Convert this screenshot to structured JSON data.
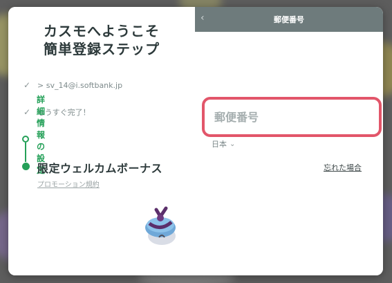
{
  "welcome": {
    "line1": "カスモへようこそ",
    "line2": "簡単登録ステップ"
  },
  "steps": [
    {
      "label": "> sv_14@i.softbank.jp",
      "status": "done"
    },
    {
      "label": "もうすぐ完了！",
      "status": "done"
    },
    {
      "label": "詳細情報の設定",
      "status": "current"
    }
  ],
  "bonus": {
    "title": "限定ウェルカムボーナス",
    "link": "プロモーション規約"
  },
  "form": {
    "header_title": "郵便番号",
    "zip_placeholder": "郵便番号",
    "zip_value": "",
    "country": "日本",
    "forgot_link": "忘れた場合"
  },
  "colors": {
    "accent_green": "#24a058",
    "focus_red": "#e2566a",
    "header_bg": "#6e7b7c"
  },
  "icons": [
    "check-icon",
    "back-arrow-icon",
    "chevron-down-icon",
    "gift-box-icon"
  ]
}
